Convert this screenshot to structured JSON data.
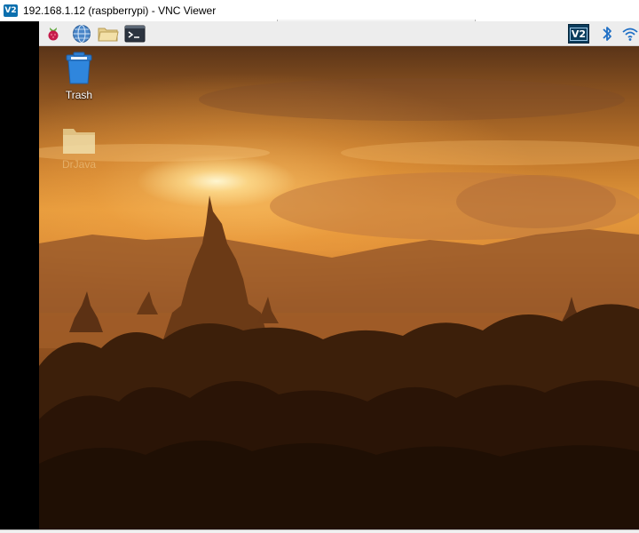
{
  "window": {
    "title": "192.168.1.12 (raspberrypi) - VNC Viewer",
    "logo_text": "V2"
  },
  "panel": {
    "launchers": [
      {
        "icon": "raspberry-menu-icon"
      },
      {
        "icon": "web-browser-globe-icon"
      },
      {
        "icon": "file-manager-folder-icon"
      },
      {
        "icon": "terminal-icon"
      }
    ],
    "tray": [
      {
        "icon": "vnc-server-icon",
        "text": "V2"
      },
      {
        "icon": "bluetooth-icon"
      },
      {
        "icon": "wifi-icon"
      }
    ]
  },
  "desktop": {
    "icons": [
      {
        "label": "Trash",
        "icon": "trash-icon"
      },
      {
        "label": "DrJava",
        "icon": "folder-icon"
      }
    ],
    "wallpaper": "sunset over temples"
  },
  "colors": {
    "panel_bg": "#ededed",
    "vnc_blue": "#0b6fae",
    "sky_orange": "#e49a3c",
    "silhouette": "#3a1d08"
  }
}
